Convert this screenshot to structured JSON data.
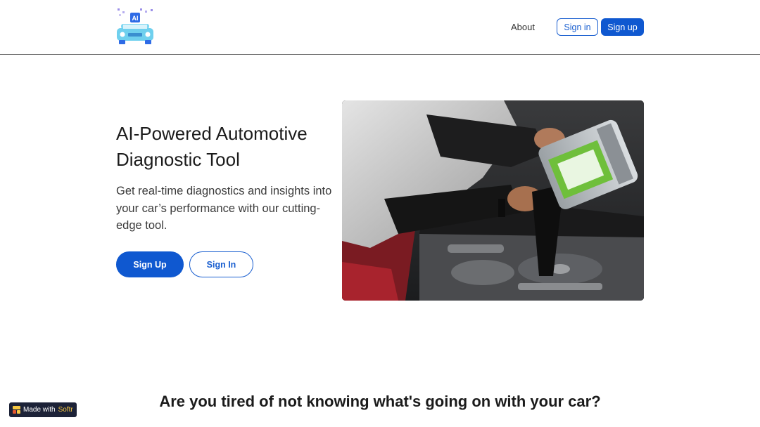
{
  "header": {
    "logo_icon": "ai-car-logo-icon",
    "logo_text": "AI",
    "nav_about": "About",
    "signin_label": "Sign in",
    "signup_label": "Sign up"
  },
  "hero": {
    "title": "AI-Powered Automotive Diagnostic Tool",
    "subtitle": "Get real-time diagnostics and insights into your car’s performance with our cutting-edge tool.",
    "signup_label": "Sign Up",
    "signin_label": "Sign In",
    "image_icon": "mechanic-pouring-oil-image"
  },
  "section": {
    "heading": "Are you tired of not knowing what's going on with your car?"
  },
  "badge": {
    "prefix": "Made with",
    "brand": "Softr",
    "icon": "softr-logo-icon"
  },
  "colors": {
    "primary": "#0f58d0",
    "border": "#6b6b6b",
    "badge_bg": "#1c2237",
    "badge_brand": "#f7c843"
  }
}
